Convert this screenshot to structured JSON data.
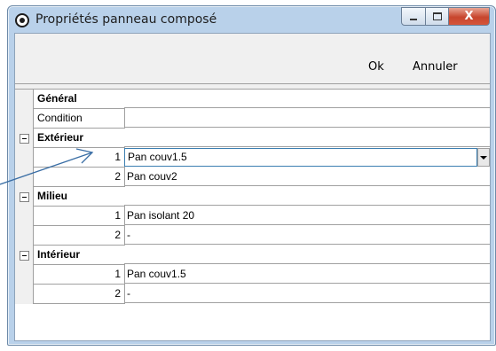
{
  "window": {
    "title": "Propriétés panneau composé",
    "close_glyph": "X"
  },
  "toolbar": {
    "ok_label": "Ok",
    "cancel_label": "Annuler"
  },
  "grid": {
    "rows": [
      {
        "key": "Général",
        "value": "",
        "type": "header"
      },
      {
        "key": "Condition",
        "value": "",
        "type": "field"
      },
      {
        "key": "Extérieur",
        "value": "",
        "type": "group"
      },
      {
        "key": "1",
        "value": "Pan couv1.5",
        "type": "item-editing"
      },
      {
        "key": "2",
        "value": "Pan couv2",
        "type": "item"
      },
      {
        "key": "Milieu",
        "value": "",
        "type": "group"
      },
      {
        "key": "1",
        "value": "Pan isolant 20",
        "type": "item"
      },
      {
        "key": "2",
        "value": "-",
        "type": "item"
      },
      {
        "key": "Intérieur",
        "value": "",
        "type": "group"
      },
      {
        "key": "1",
        "value": "Pan couv1.5",
        "type": "item"
      },
      {
        "key": "2",
        "value": "-",
        "type": "item"
      }
    ]
  },
  "colors": {
    "window_frame": "#b9d1ea",
    "close_button": "#c7452d",
    "editor_border": "#3c7fb1",
    "annotation_arrow": "#3a6ea5"
  }
}
